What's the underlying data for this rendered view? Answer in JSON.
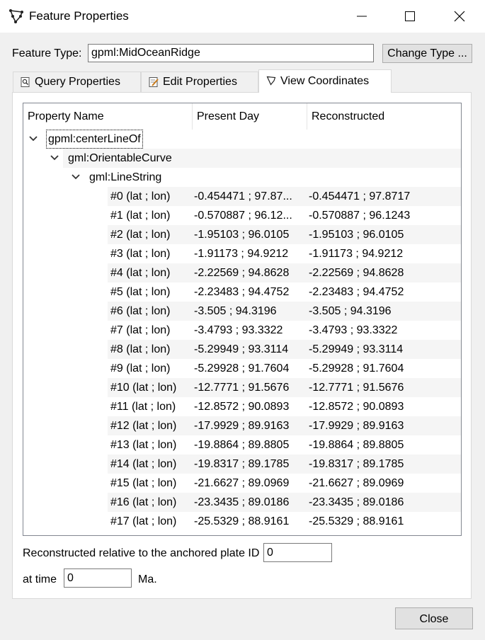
{
  "window": {
    "title": "Feature Properties"
  },
  "feature_type": {
    "label": "Feature Type:",
    "value": "gpml:MidOceanRidge",
    "change_button": "Change Type ..."
  },
  "tabs": [
    {
      "label": "Query Properties",
      "icon": "magnifier-page-icon"
    },
    {
      "label": "Edit Properties",
      "icon": "edit-page-icon"
    },
    {
      "label": "View Coordinates",
      "icon": "polygon-icon"
    }
  ],
  "tree": {
    "headers": [
      "Property Name",
      "Present Day",
      "Reconstructed"
    ],
    "root": "gpml:centerLineOf",
    "child": "gml:OrientableCurve",
    "grandchild": "gml:LineString",
    "rows": [
      [
        "#0 (lat ; lon)",
        "-0.454471 ; 97.87...",
        "-0.454471 ; 97.8717"
      ],
      [
        "#1 (lat ; lon)",
        "-0.570887 ; 96.12...",
        "-0.570887 ; 96.1243"
      ],
      [
        "#2 (lat ; lon)",
        "-1.95103 ; 96.0105",
        "-1.95103 ; 96.0105"
      ],
      [
        "#3 (lat ; lon)",
        "-1.91173 ; 94.9212",
        "-1.91173 ; 94.9212"
      ],
      [
        "#4 (lat ; lon)",
        "-2.22569 ; 94.8628",
        "-2.22569 ; 94.8628"
      ],
      [
        "#5 (lat ; lon)",
        "-2.23483 ; 94.4752",
        "-2.23483 ; 94.4752"
      ],
      [
        "#6 (lat ; lon)",
        "-3.505 ; 94.3196",
        "-3.505 ; 94.3196"
      ],
      [
        "#7 (lat ; lon)",
        "-3.4793 ; 93.3322",
        "-3.4793 ; 93.3322"
      ],
      [
        "#8 (lat ; lon)",
        "-5.29949 ; 93.3114",
        "-5.29949 ; 93.3114"
      ],
      [
        "#9 (lat ; lon)",
        "-5.29928 ; 91.7604",
        "-5.29928 ; 91.7604"
      ],
      [
        "#10 (lat ; lon)",
        "-12.7771 ; 91.5676",
        "-12.7771 ; 91.5676"
      ],
      [
        "#11 (lat ; lon)",
        "-12.8572 ; 90.0893",
        "-12.8572 ; 90.0893"
      ],
      [
        "#12 (lat ; lon)",
        "-17.9929 ; 89.9163",
        "-17.9929 ; 89.9163"
      ],
      [
        "#13 (lat ; lon)",
        "-19.8864 ; 89.8805",
        "-19.8864 ; 89.8805"
      ],
      [
        "#14 (lat ; lon)",
        "-19.8317 ; 89.1785",
        "-19.8317 ; 89.1785"
      ],
      [
        "#15 (lat ; lon)",
        "-21.6627 ; 89.0969",
        "-21.6627 ; 89.0969"
      ],
      [
        "#16 (lat ; lon)",
        "-23.3435 ; 89.0186",
        "-23.3435 ; 89.0186"
      ],
      [
        "#17 (lat ; lon)",
        "-25.5329 ; 88.9161",
        "-25.5329 ; 88.9161"
      ]
    ]
  },
  "reconstruction": {
    "plate_label": "Reconstructed relative to the anchored plate ID",
    "plate_value": "0",
    "time_label": "at time",
    "time_value": "0",
    "time_unit": "Ma."
  },
  "close_button": "Close"
}
